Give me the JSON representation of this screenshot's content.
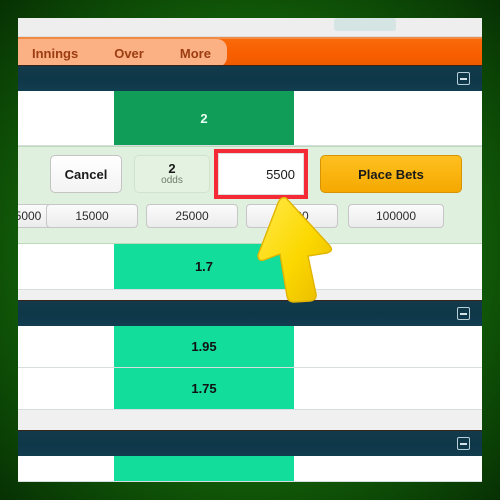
{
  "app": {
    "accent_orange": "#f85e00",
    "nav_tab_bg": "#fbb183",
    "section_header_bg": "#0e3748",
    "odds_dark_green": "#0f9d58",
    "odds_bright_green": "#12dd9b",
    "highlight_red": "#f42b36",
    "place_bets_yellow": "#f5a800",
    "frame_green": "#17750c"
  },
  "topbar": {
    "balance_amount": "",
    "pill_label": ""
  },
  "nav": {
    "tabs": [
      {
        "label": "Innings"
      },
      {
        "label": "Over"
      },
      {
        "label": "More"
      }
    ]
  },
  "sections": [
    {
      "collapse_icon": "minus-icon"
    },
    {
      "collapse_icon": "minus-icon"
    },
    {
      "collapse_icon": "minus-icon"
    }
  ],
  "markets": {
    "rows": [
      {
        "odds": "2",
        "style": "dark"
      },
      {
        "odds": "1.7",
        "style": "bright"
      },
      {
        "odds": "1.95",
        "style": "bright"
      },
      {
        "odds": "1.75",
        "style": "bright"
      }
    ]
  },
  "betslip": {
    "cancel_label": "Cancel",
    "odds_value": "2",
    "odds_label": "odds",
    "stake_value": "5500",
    "stake_placeholder": "0",
    "place_bets_label": "Place Bets",
    "quick_stakes": [
      {
        "label": "5000",
        "partial": true
      },
      {
        "label": "15000",
        "partial": false
      },
      {
        "label": "25000",
        "partial": false
      },
      {
        "label": "50000",
        "partial": false
      },
      {
        "label": "100000",
        "partial": false
      }
    ]
  },
  "annotation": {
    "highlight_target": "stake-input",
    "cursor": "yellow-arrow-cursor"
  }
}
